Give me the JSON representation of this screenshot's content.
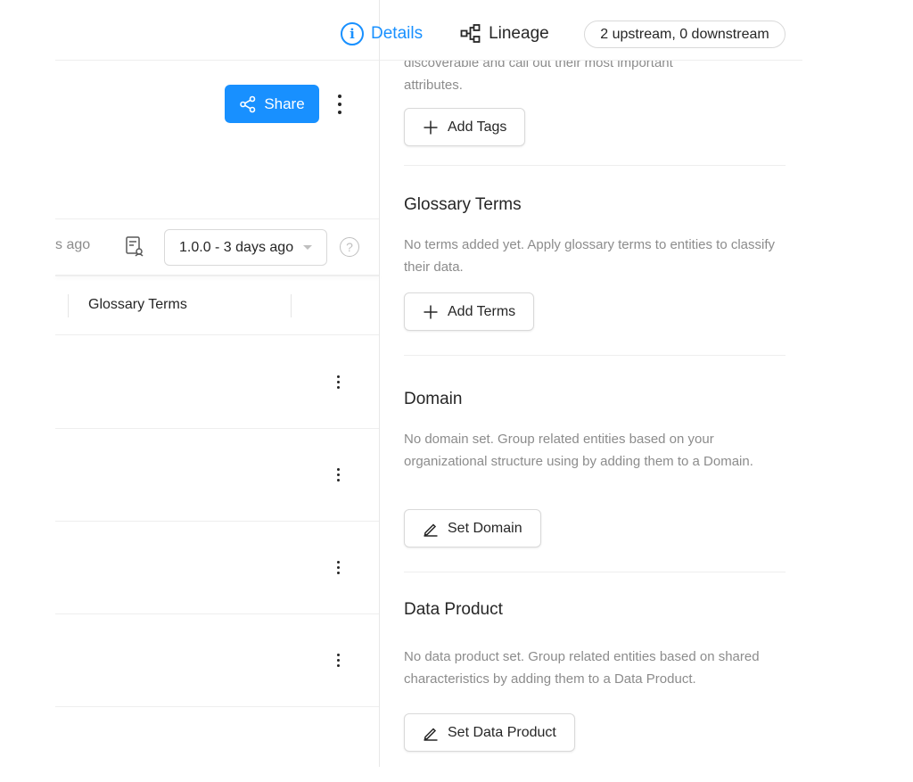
{
  "tabs": {
    "details_label": "Details",
    "lineage_label": "Lineage",
    "lineage_summary": "2 upstream, 0 downstream"
  },
  "toolbar": {
    "share_label": "Share"
  },
  "version_bar": {
    "ago_text": "s ago",
    "version_value": "1.0.0 - 3 days ago",
    "help_glyph": "?"
  },
  "table": {
    "column_header": "Glossary Terms",
    "row_count": 4
  },
  "tags": {
    "desc_line1": "discoverable and call out their most important",
    "desc_line2": "attributes.",
    "add_label": "Add Tags"
  },
  "glossary": {
    "title": "Glossary Terms",
    "desc": "No terms added yet. Apply glossary terms to entities to classify their data.",
    "add_label": "Add Terms"
  },
  "domain": {
    "title": "Domain",
    "desc": "No domain set. Group related entities based on your organizational structure using by adding them to a Domain.",
    "set_label": "Set Domain"
  },
  "data_product": {
    "title": "Data Product",
    "desc": "No data product set. Group related entities based on shared characteristics by adding them to a Data Product.",
    "set_label": "Set Data Product"
  },
  "colors": {
    "accent": "#1890ff",
    "text": "#262626",
    "muted": "#8c8c8c",
    "border": "#d9d9d9"
  },
  "icons": {
    "details": "info-icon",
    "lineage": "lineage-icon",
    "share": "share-icon",
    "history": "history-icon",
    "add": "plus-icon",
    "edit": "pencil-icon"
  }
}
